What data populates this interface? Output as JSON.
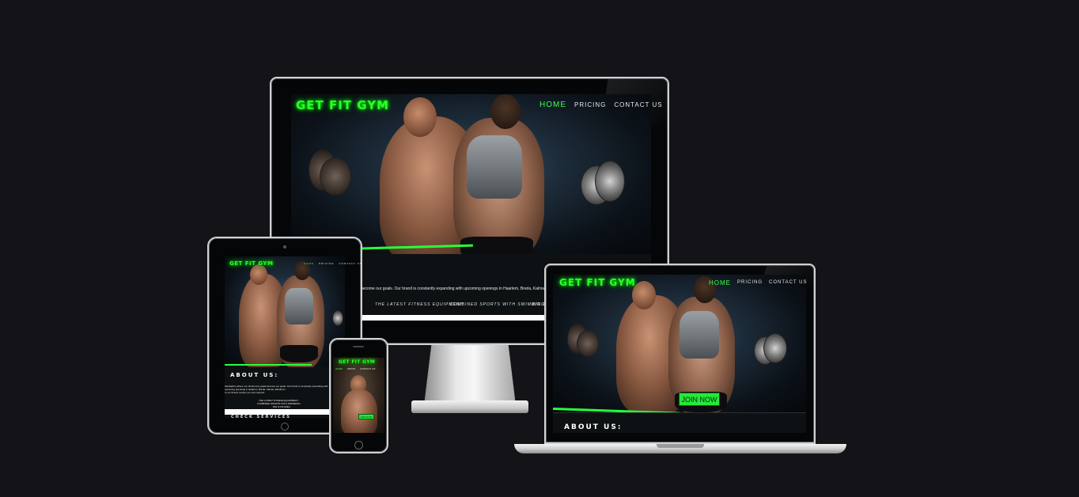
{
  "site": {
    "logo": "GET FIT GYM",
    "nav": [
      "HOME",
      "PRICING",
      "CONTACT US"
    ],
    "nav_short": [
      "HOME",
      "PRICIN",
      "CONTACT US"
    ],
    "cta": "JOIN NOW",
    "about_title": "ABOUT US:",
    "about_text_desktop": "become our goals. Our brand is constantly expanding with upcoming openings in Haarlem, Breda, Kalmar, Zaanfoon.",
    "about_text_tablet_1": "Zandedam where our clients truly goals become our goals. Our brand is constantly expanding with",
    "about_text_tablet_2": "upcoming openings in Haarlem, Breda, Kalmar, Zaanfoon.",
    "about_text_tablet_3": "to our fitness centers you are inspired.",
    "features_desktop": [
      "THE LATEST FITNESS EQUIPMENT",
      "COMBINED SPORTS WITH SWIMMING",
      "BIG SP"
    ],
    "features_tablet": [
      "THE LATEST FITNESS EQUIPMENT",
      "COMBINED SPORTS WITH SWIMMING",
      "BIG GYM AREA"
    ],
    "tablet_bottom_title": "CHECK SERVICES"
  },
  "colors": {
    "background": "#141418",
    "accent_green": "#27ff3a",
    "nav_text": "#e8e8e8"
  },
  "icons": [
    "dumbbell-icon",
    "device-camera-icon",
    "home-button-icon"
  ]
}
